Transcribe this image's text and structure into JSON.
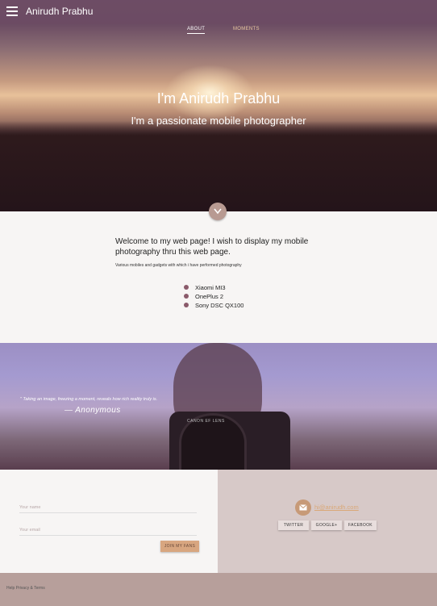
{
  "header": {
    "site_title": "Anirudh Prabhu",
    "tabs": [
      {
        "label": "ABOUT",
        "active": true
      },
      {
        "label": "MOMENTS",
        "active": false
      }
    ],
    "colors": {
      "bar": "#6e4b64",
      "accent": "#e8c8a0"
    }
  },
  "hero": {
    "title": "I'm Anirudh Prabhu",
    "subtitle": "I'm a passionate mobile photographer",
    "down_icon": "chevron-down-icon"
  },
  "about": {
    "welcome": "Welcome to my web page! I wish to display my mobile photography thru this web page.",
    "small_text": "Various mobiles and gadgets with which i have performed photography",
    "devices": [
      "Xiaomi MI3",
      "OnePlus 2",
      "Sony DSC QX100"
    ]
  },
  "quote": {
    "text": "\" Taking an image, freezing a moment, reveals how rich reality truly is.",
    "author": "— Anonymous",
    "lens_text": "CANON EF LENS"
  },
  "contact": {
    "name_label": "Your name",
    "email_label": "Your email",
    "join_label": "JOIN MY FANS",
    "email_link": "hi@anirudh.com",
    "mail_icon": "mail-icon",
    "social": [
      "TWITTER",
      "GOOGLE+",
      "FACEBOOK"
    ]
  },
  "footer": {
    "links": "Help  Privacy & Terms"
  }
}
